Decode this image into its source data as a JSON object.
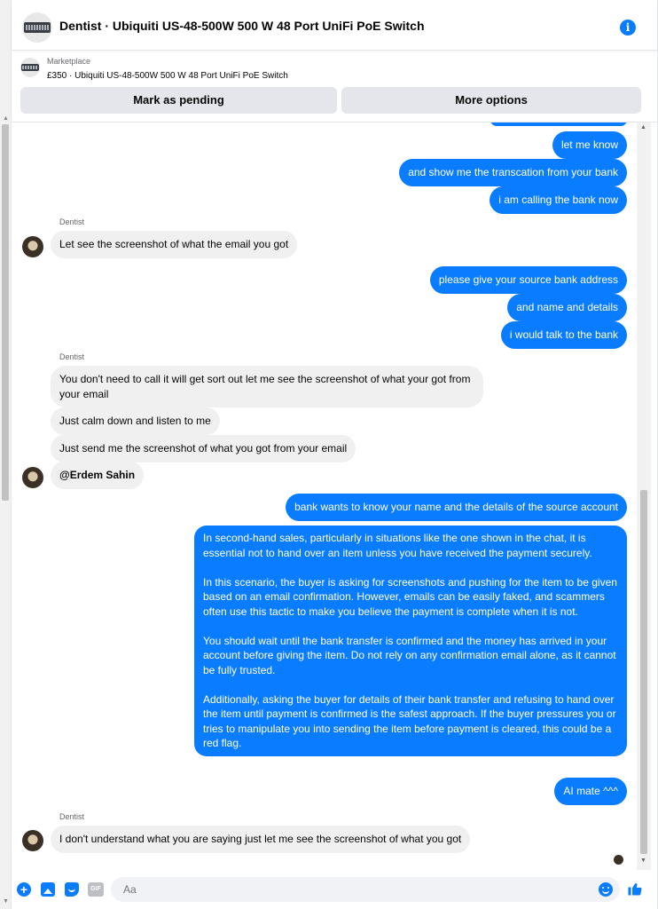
{
  "header": {
    "title": "Dentist · Ubiquiti US-48-500W 500 W 48 Port UniFi PoE Switch",
    "info_icon": "info-icon"
  },
  "listing": {
    "source": "Marketplace",
    "price_title": "£350 · Ubiquiti US-48-500W 500 W 48 Port UniFi PoE Switch",
    "mark_pending": "Mark as pending",
    "more_options": "More options"
  },
  "messages": {
    "out1": "let me know",
    "out2": "and show me the transcation from your bank",
    "out3": "i am calling the bank now",
    "sender1": "Dentist",
    "in1": "Let see the screenshot of what the email you got",
    "out4": "please give your source bank address",
    "out5": "and name and details",
    "out6": "i would talk to the bank",
    "sender2": "Dentist",
    "in2": "You don't need to call it will get sort out let me see the screenshot of what your got from your email",
    "in3": "Just calm down and listen to me",
    "in4": "Just send me the screenshot of what you got from your email",
    "in5": "@Erdem Sahin",
    "out7": "bank wants to know your name and the details of the source account",
    "long": [
      "In second-hand sales, particularly in situations like the one shown in the chat, it is essential not to hand over an item unless you have received the payment securely.",
      "In this scenario, the buyer is asking for screenshots and pushing for the item to be given based on an email confirmation. However, emails can be easily faked, and scammers often use this tactic to make you believe the payment is complete when it is not.",
      "You should wait until the bank transfer is confirmed and the money has arrived in your account before giving the item. Do not rely on any confirmation email alone, as it cannot be fully trusted.",
      "Additionally, asking the buyer for details of their bank transfer and refusing to hand over the item until payment is confirmed is the safest approach. If the buyer pressures you or tries to manipulate you into sending the item before payment is cleared, this could be a red flag."
    ],
    "out8": "AI mate ^^^",
    "sender3": "Dentist",
    "in6": "I don't understand what you are saying just let me see the screenshot of what you got"
  },
  "composer": {
    "placeholder": "Aa",
    "gif_label": "GIF"
  },
  "colors": {
    "accent": "#0a7cff",
    "incoming_bubble": "#f0f0f0",
    "button_bg": "#e4e6eb"
  }
}
